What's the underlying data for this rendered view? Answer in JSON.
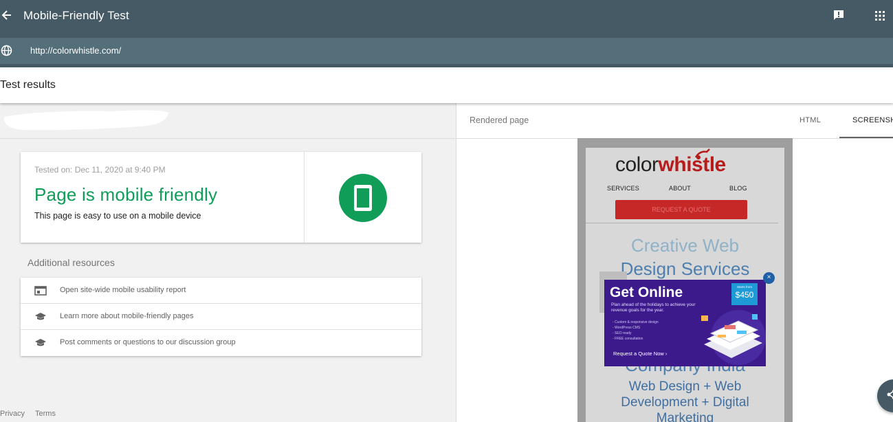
{
  "header": {
    "title": "Mobile-Friendly Test",
    "url": "http://colorwhistle.com/"
  },
  "results": {
    "title": "Test results"
  },
  "summary": {
    "tested_on": "Tested on: Dec 11, 2020 at 9:40 PM",
    "verdict": "Page is mobile friendly",
    "description": "This page is easy to use on a mobile device",
    "status_color": "#0f9d58"
  },
  "additional": {
    "heading": "Additional resources",
    "items": [
      {
        "label": "Open site-wide mobile usability report",
        "icon": "report-icon"
      },
      {
        "label": "Learn more about mobile-friendly pages",
        "icon": "school-icon"
      },
      {
        "label": "Post comments or questions to our discussion group",
        "icon": "school-icon"
      }
    ]
  },
  "footer": {
    "privacy": "Privacy",
    "terms": "Terms"
  },
  "rendered": {
    "label": "Rendered page",
    "tabs": [
      {
        "label": "HTML"
      },
      {
        "label": "SCREENSH"
      }
    ],
    "site": {
      "brand_a": "color",
      "brand_b": "whistle",
      "nav": [
        "SERVICES",
        "ABOUT",
        "BLOG"
      ],
      "cta": "REQUEST A QUOTE",
      "hero_lines": [
        "Creative Web",
        "Design Services"
      ],
      "hero_tail": "Company India",
      "hero2_lines": [
        "Web Design + Web",
        "Development + Digital",
        "Marketing"
      ]
    },
    "popup": {
      "title": "Get Online",
      "subtitle": "Plan ahead of the holidays to achieve your revenue goals for the year.",
      "bullets": [
        "- Custom & responsive design",
        "- WordPress CMS",
        "- SEO ready",
        "- FREE consultation"
      ],
      "price_small": "Starts from",
      "price": "$450",
      "cta": "Request a Quote Now",
      "close": "×"
    }
  },
  "colors": {
    "topbar": "#455a64",
    "urlbar": "#546e7a",
    "accent_green": "#0f9d58"
  }
}
